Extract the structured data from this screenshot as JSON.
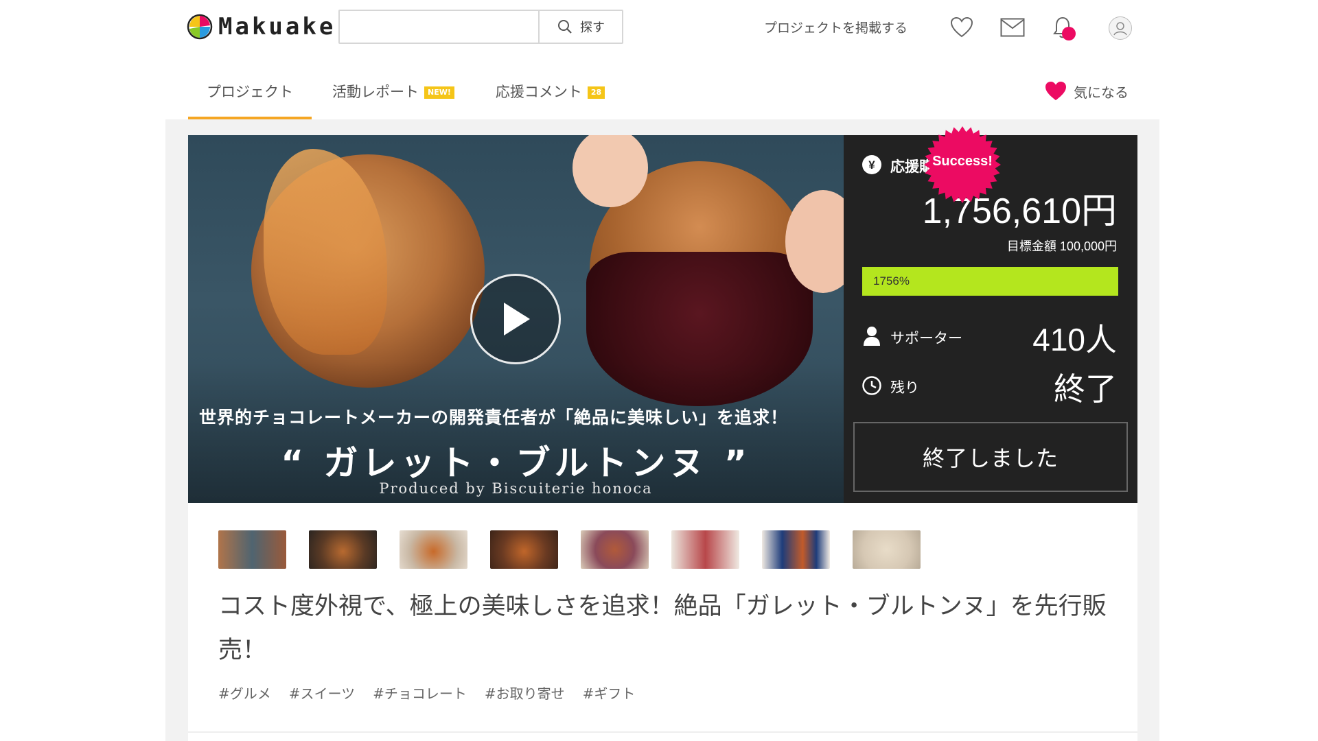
{
  "header": {
    "logo_text": "Makuake",
    "search": {
      "placeholder": "",
      "button_label": "探す"
    },
    "post_project_label": "プロジェクトを掲載する",
    "icons": [
      "heart-icon",
      "mail-icon",
      "bell-icon",
      "avatar"
    ]
  },
  "tabs": [
    {
      "label": "プロジェクト",
      "active": true
    },
    {
      "label": "活動レポート",
      "badge": "NEW!"
    },
    {
      "label": "応援コメント",
      "badge": "28"
    }
  ],
  "favorite_label": "気になる",
  "hero": {
    "tagline": "世界的チョコレートメーカーの開発責任者が「絶品に美味しい」を追求！",
    "title": "“ ガレット・ブルトンヌ ”",
    "produced_by": "Produced by Biscuiterie honoca"
  },
  "stats": {
    "total_label": "応援購入総額",
    "total_value": "1,756,610円",
    "goal_text": "目標金額 100,000円",
    "progress_text": "1756%",
    "progress_fraction": 1.0,
    "supporters_label": "サポーター",
    "supporters_value": "410人",
    "remaining_label": "残り",
    "remaining_value": "終了",
    "status_button": "終了しました",
    "success_badge": "Success!"
  },
  "thumbnails": 8,
  "description": {
    "title": "コスト度外視で、極上の美味しさを追求！絶品「ガレット・ブルトンヌ」を先行販売！",
    "tags": [
      "#グルメ",
      "#スイーツ",
      "#チョコレート",
      "#お取り寄せ",
      "#ギフト"
    ]
  },
  "colors": {
    "accent_tab": "#f5a623",
    "badge": "#f5c518",
    "progress": "#b4e61e",
    "success": "#ec0b62",
    "panel": "#222222"
  }
}
